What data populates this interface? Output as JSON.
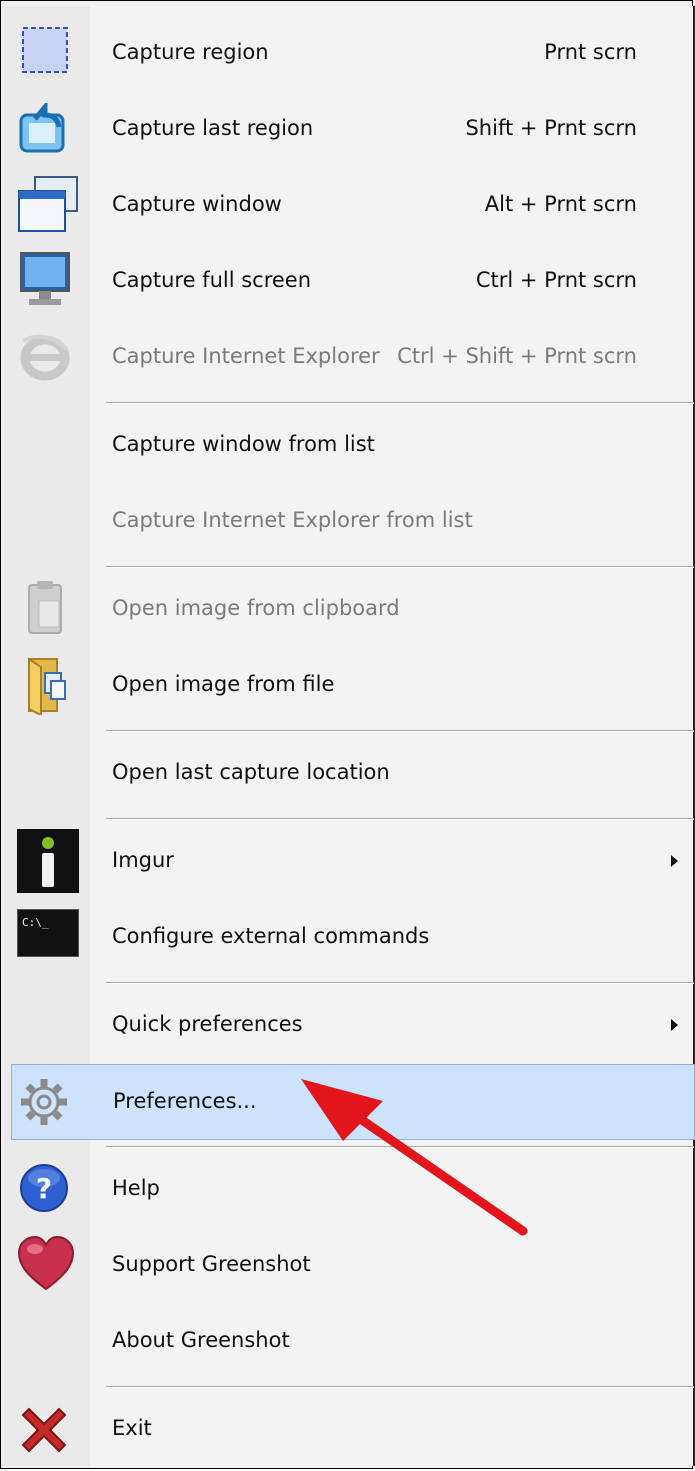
{
  "menu": {
    "items": [
      {
        "label": "Capture region",
        "shortcut": "Prnt scrn",
        "icon": "capture-region-icon"
      },
      {
        "label": "Capture last region",
        "shortcut": "Shift + Prnt scrn",
        "icon": "capture-last-region-icon"
      },
      {
        "label": "Capture window",
        "shortcut": "Alt + Prnt scrn",
        "icon": "capture-window-icon"
      },
      {
        "label": "Capture full screen",
        "shortcut": "Ctrl + Prnt scrn",
        "icon": "monitor-icon"
      },
      {
        "label": "Capture Internet Explorer",
        "shortcut": "Ctrl + Shift + Prnt scrn",
        "icon": "internet-explorer-icon",
        "disabled": true
      },
      {
        "label": "Capture window from list"
      },
      {
        "label": "Capture Internet Explorer from list",
        "disabled": true
      },
      {
        "label": "Open image from clipboard",
        "icon": "clipboard-icon",
        "disabled": true
      },
      {
        "label": "Open image from file",
        "icon": "folder-icon"
      },
      {
        "label": "Open last capture location"
      },
      {
        "label": "Imgur",
        "icon": "imgur-icon",
        "submenu": true
      },
      {
        "label": "Configure external commands",
        "icon": "command-prompt-icon"
      },
      {
        "label": "Quick preferences",
        "submenu": true
      },
      {
        "label": "Preferences...",
        "icon": "gear-icon",
        "highlighted": true
      },
      {
        "label": "Help",
        "icon": "help-icon"
      },
      {
        "label": "Support Greenshot",
        "icon": "heart-icon"
      },
      {
        "label": "About Greenshot"
      },
      {
        "label": "Exit",
        "icon": "close-icon"
      }
    ],
    "cmd_icon_text": "C:\\_"
  },
  "colors": {
    "highlight": "#cde3fb",
    "annotation_arrow": "#e3141b",
    "disabled_text": "#7a7a7a"
  }
}
